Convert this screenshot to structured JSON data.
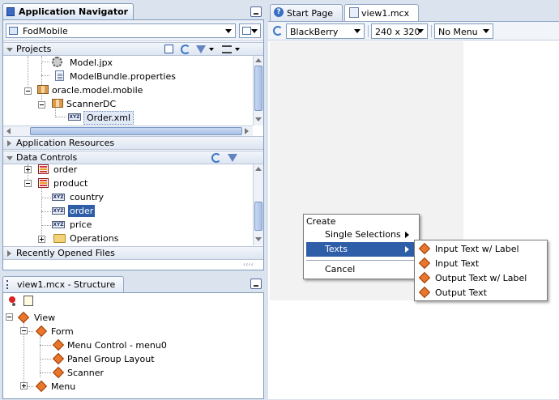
{
  "navigator": {
    "title": "Application Navigator",
    "app_selector": "FodMobile",
    "projects_label": "Projects",
    "project_items": [
      {
        "label": "Model.jpx"
      },
      {
        "label": "ModelBundle.properties"
      },
      {
        "label": "oracle.model.mobile"
      },
      {
        "label": "ScannerDC"
      },
      {
        "label": "Order.xml"
      }
    ],
    "app_resources_label": "Application Resources",
    "data_controls_label": "Data Controls",
    "dc_items": [
      {
        "label": "order"
      },
      {
        "label": "product"
      },
      {
        "label": "country"
      },
      {
        "label": "order"
      },
      {
        "label": "price"
      },
      {
        "label": "Operations"
      }
    ],
    "recent_files_label": "Recently Opened Files"
  },
  "structure": {
    "title": "view1.mcx - Structure",
    "items": [
      {
        "label": "View"
      },
      {
        "label": "Form"
      },
      {
        "label": "Menu Control - menu0"
      },
      {
        "label": "Panel Group Layout"
      },
      {
        "label": "Scanner"
      },
      {
        "label": "Menu"
      }
    ]
  },
  "editor": {
    "tabs": [
      {
        "label": "Start Page"
      },
      {
        "label": "view1.mcx"
      }
    ],
    "device_select": "BlackBerry",
    "size_select": "240 x 320",
    "menu_select": "No Menu"
  },
  "context_menu": {
    "header": "Create",
    "items": [
      {
        "label": "Single Selections"
      },
      {
        "label": "Texts"
      },
      {
        "label": "Cancel"
      }
    ],
    "submenu": [
      {
        "label": "Input Text w/ Label"
      },
      {
        "label": "Input Text"
      },
      {
        "label": "Output Text w/ Label"
      },
      {
        "label": "Output Text"
      }
    ]
  }
}
